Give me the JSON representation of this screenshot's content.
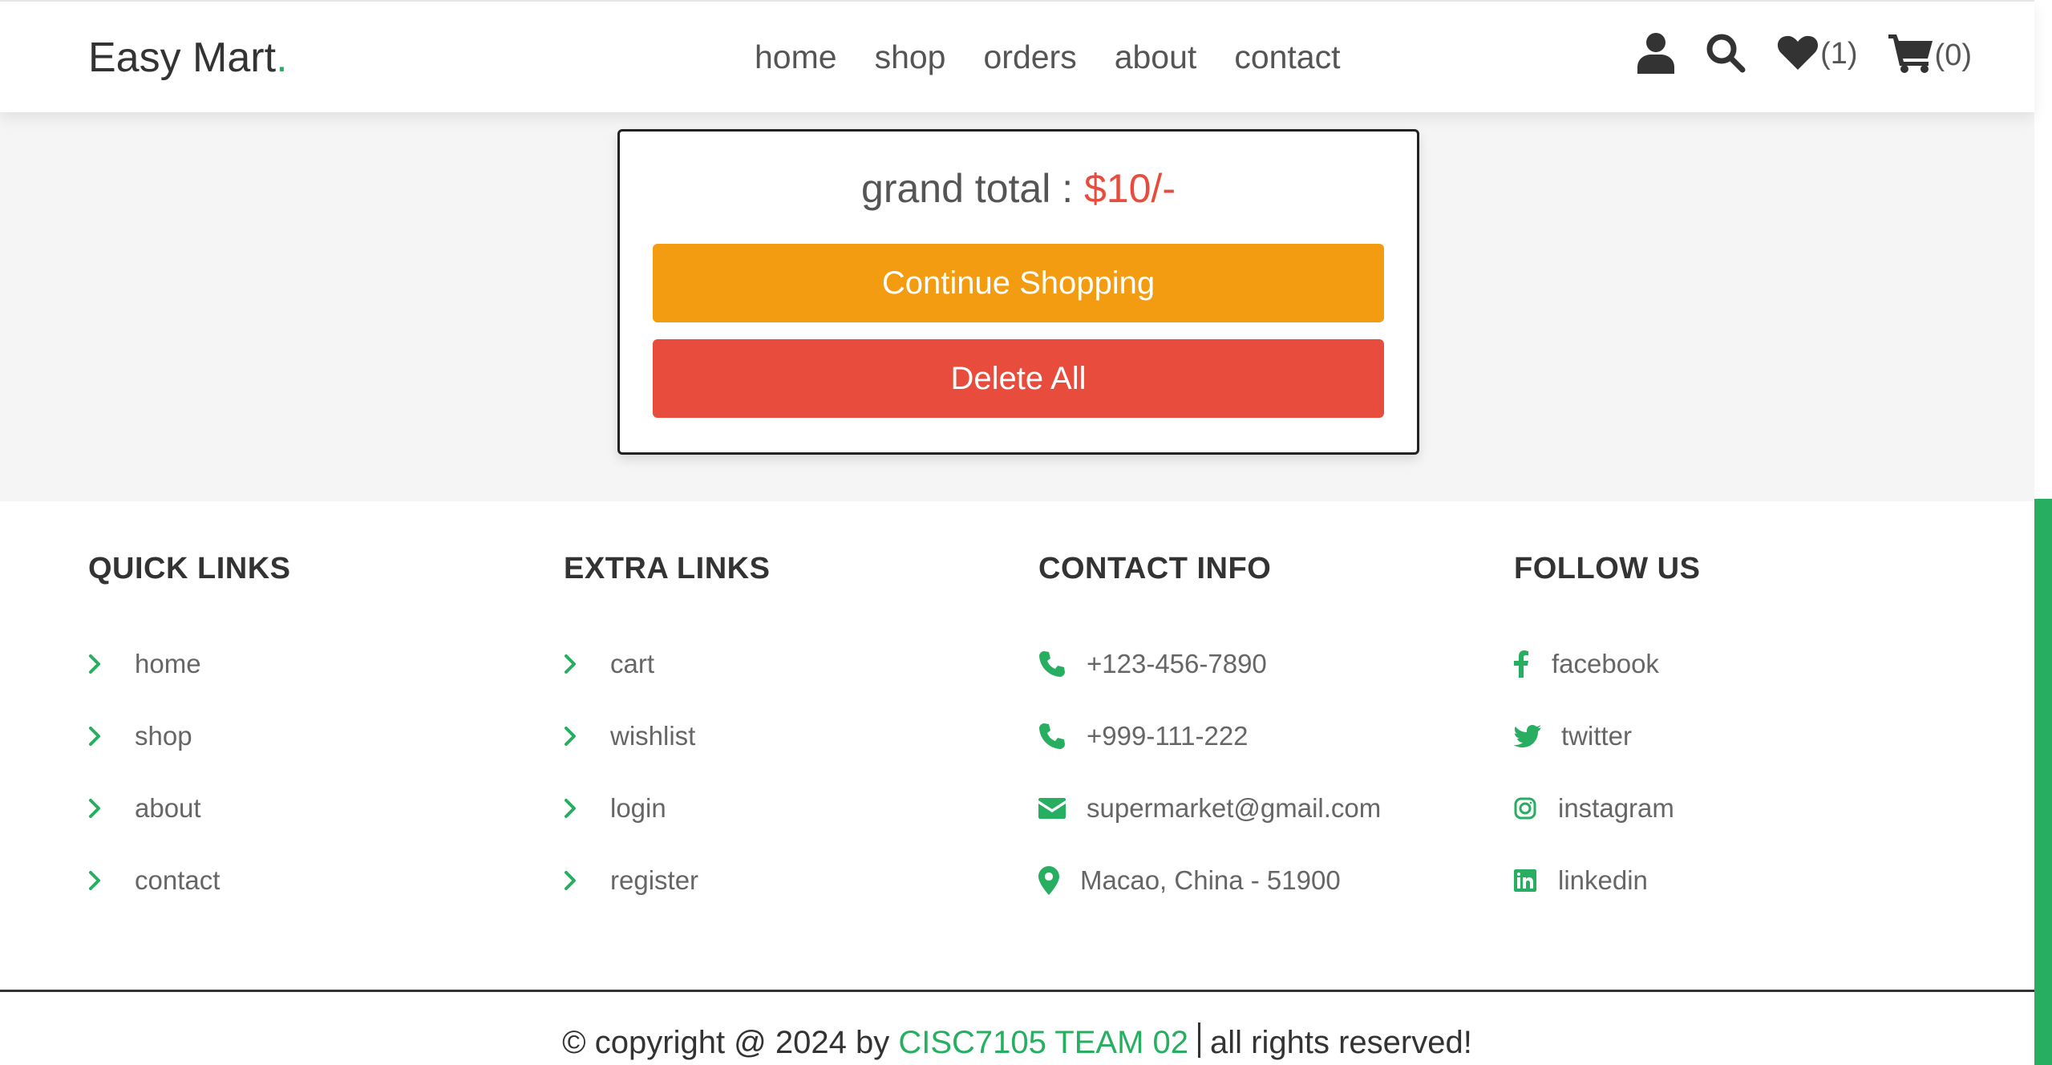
{
  "header": {
    "logo_text": "Easy Mart",
    "logo_dot": ".",
    "nav": [
      "home",
      "shop",
      "orders",
      "about",
      "contact"
    ],
    "wishlist_count": "(1)",
    "cart_count": "(0)"
  },
  "cart_total": {
    "label": "grand total : ",
    "amount": "$10/-",
    "continue_label": "Continue Shopping",
    "delete_label": "Delete All"
  },
  "footer": {
    "quick_links": {
      "title": "QUICK LINKS",
      "items": [
        "home",
        "shop",
        "about",
        "contact"
      ]
    },
    "extra_links": {
      "title": "EXTRA LINKS",
      "items": [
        "cart",
        "wishlist",
        "login",
        "register"
      ]
    },
    "contact_info": {
      "title": "CONTACT INFO",
      "phone1": "+123-456-7890",
      "phone2": "+999-111-222",
      "email": "supermarket@gmail.com",
      "address": "Macao, China - 51900"
    },
    "follow_us": {
      "title": "FOLLOW US",
      "items": [
        "facebook",
        "twitter",
        "instagram",
        "linkedin"
      ]
    },
    "credit": {
      "prefix": "© copyright @ 2024 by ",
      "team": "CISC7105 TEAM 02",
      "suffix": "all rights reserved!"
    }
  },
  "colors": {
    "accent": "#27ae60",
    "price": "#e74c3c",
    "continue_button": "#f39c12",
    "delete_button": "#e74c3c"
  }
}
